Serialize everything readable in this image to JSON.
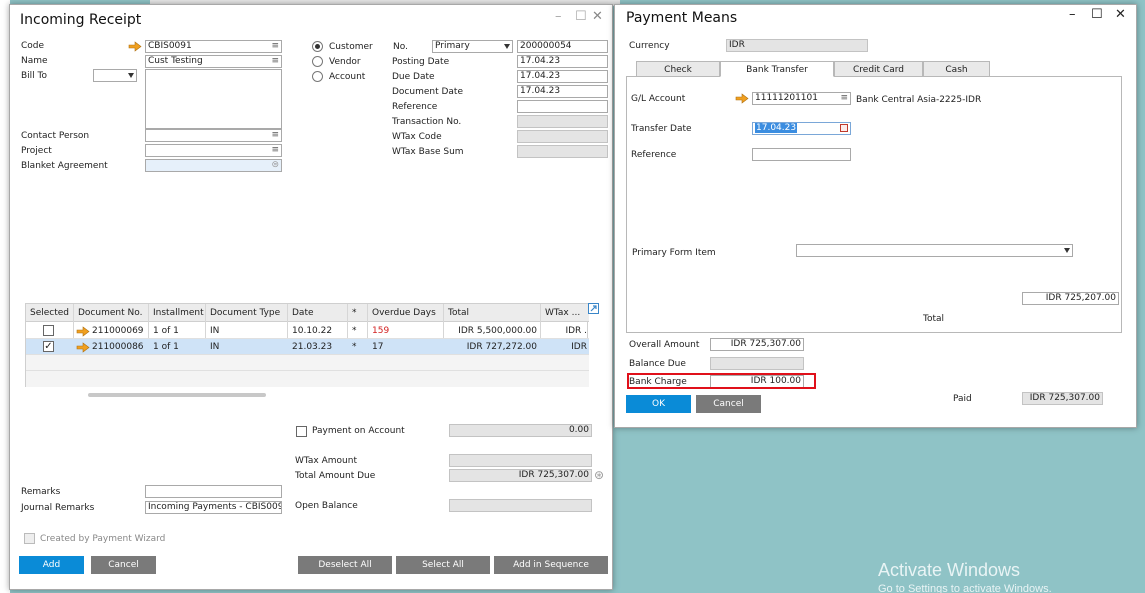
{
  "incoming_receipt": {
    "title": "Incoming Receipt",
    "code_label": "Code",
    "code_value": "CBIS0091",
    "name_label": "Name",
    "name_value": "Cust Testing",
    "bill_to_label": "Bill To",
    "contact_person_label": "Contact Person",
    "project_label": "Project",
    "blanket_agreement_label": "Blanket Agreement",
    "radio_customer": "Customer",
    "radio_vendor": "Vendor",
    "radio_account": "Account",
    "no_label": "No.",
    "series_value": "Primary",
    "no_value": "200000054",
    "posting_date_label": "Posting Date",
    "posting_date_value": "17.04.23",
    "due_date_label": "Due Date",
    "due_date_value": "17.04.23",
    "document_date_label": "Document Date",
    "document_date_value": "17.04.23",
    "reference_label": "Reference",
    "transaction_no_label": "Transaction No.",
    "wtax_code_label": "WTax Code",
    "wtax_base_sum_label": "WTax Base Sum",
    "grid": {
      "headers": [
        "Selected",
        "Document No.",
        "Installment",
        "Document Type",
        "Date",
        "*",
        "Overdue Days",
        "Total",
        "WTax ..."
      ],
      "rows": [
        {
          "selected": false,
          "doc_no": "211000069",
          "installment": "1 of 1",
          "doc_type": "IN",
          "date": "10.10.22",
          "star": "*",
          "overdue": "159",
          "total": "IDR 5,500,000.00",
          "wtax": "IDR ."
        },
        {
          "selected": true,
          "doc_no": "211000086",
          "installment": "1 of 1",
          "doc_type": "IN",
          "date": "21.03.23",
          "star": "*",
          "overdue": "17",
          "total": "IDR 727,272.00",
          "wtax": "IDR"
        }
      ]
    },
    "payment_on_account_label": "Payment on Account",
    "payment_on_account_value": "0.00",
    "wtax_amount_label": "WTax Amount",
    "total_amount_due_label": "Total Amount Due",
    "total_amount_due_value": "IDR 725,307.00",
    "open_balance_label": "Open Balance",
    "remarks_label": "Remarks",
    "journal_remarks_label": "Journal Remarks",
    "journal_remarks_value": "Incoming Payments - CBIS009",
    "created_by_wizard_label": "Created by Payment Wizard",
    "buttons": {
      "add": "Add",
      "cancel": "Cancel",
      "deselect_all": "Deselect All",
      "select_all": "Select All",
      "add_in_sequence": "Add in Sequence"
    }
  },
  "payment_means": {
    "title": "Payment Means",
    "currency_label": "Currency",
    "currency_value": "IDR",
    "tabs": [
      "Check",
      "Bank Transfer",
      "Credit Card",
      "Cash"
    ],
    "active_tab": "Bank Transfer",
    "gl_account_label": "G/L Account",
    "gl_account_value": "11111201101",
    "gl_account_name": "Bank Central Asia-2225-IDR",
    "transfer_date_label": "Transfer Date",
    "transfer_date_value": "17.04.23",
    "reference_label": "Reference",
    "primary_form_item_label": "Primary Form Item",
    "total_value": "IDR 725,207.00",
    "total_label": "Total",
    "overall_amount_label": "Overall Amount",
    "overall_amount_value": "IDR 725,307.00",
    "balance_due_label": "Balance Due",
    "bank_charge_label": "Bank Charge",
    "bank_charge_value": "IDR 100.00",
    "paid_label": "Paid",
    "paid_value": "IDR 725,307.00",
    "ok_label": "OK",
    "cancel_label": "Cancel"
  },
  "watermark": {
    "line1": "Activate Windows",
    "line2": "Go to Settings to activate Windows."
  },
  "colors": {
    "desktop": "#8fc3c6",
    "accent_blue": "#0a8bd7",
    "button_gray": "#7a7a7a",
    "selected_row": "#cfe3f7",
    "highlight_red": "#e0101a",
    "overdue_red": "#d21f1f",
    "link_arrow": "#f0a020"
  }
}
